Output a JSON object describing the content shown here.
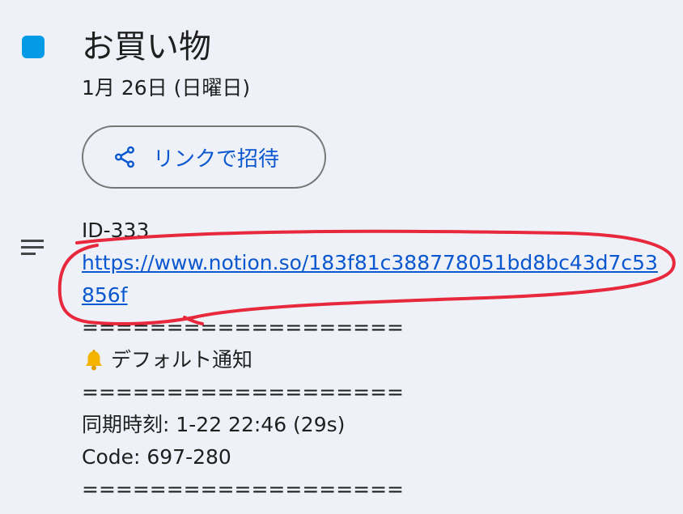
{
  "event": {
    "title": "お買い物",
    "date": "1月 26日 (日曜日)",
    "color": "#039be5"
  },
  "invite": {
    "label": "リンクで招待",
    "icon": "share-icon"
  },
  "description": {
    "icon": "notes-icon",
    "id_line": "ID-333",
    "link": "https://www.notion.so/183f81c388778051bd8bc43d7c53856f",
    "separator_1": "===================",
    "notification_icon": "bell-icon",
    "notification": "デフォルト通知",
    "separator_2": "===================",
    "sync_time": "同期時刻: 1-22 22:46 (29s)",
    "code": "Code: 697-280",
    "separator_3": "==================="
  },
  "annotation": {
    "color": "#e8283c"
  }
}
